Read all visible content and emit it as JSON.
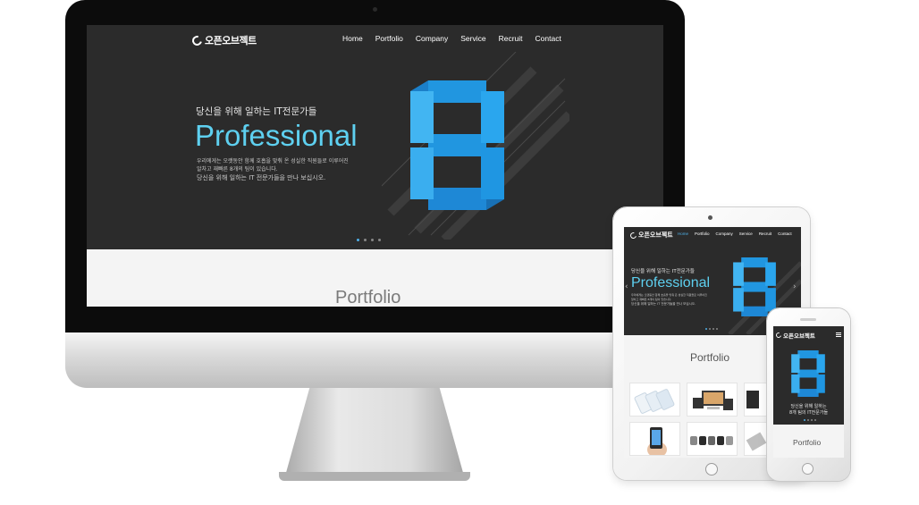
{
  "brand": {
    "name": "오픈오브젝트",
    "accent_color": "#5ed0f0",
    "hero_background": "#2b2b2b",
    "logo_icon": "ring-logo-icon"
  },
  "nav": {
    "items": [
      {
        "label": "Home"
      },
      {
        "label": "Portfolio"
      },
      {
        "label": "Company"
      },
      {
        "label": "Service"
      },
      {
        "label": "Recruit"
      },
      {
        "label": "Contact"
      }
    ],
    "active_color": "#4fb0e8",
    "menu_icon": "hamburger-menu-icon"
  },
  "hero": {
    "subtitle": "당신을 위해 일하는 IT전문가들",
    "title": "Professional",
    "desc_line_1": "우리에게는 오랫동안 함께 호흡을 맞춰 온 성실한 직원들로 이루어진",
    "desc_line_2": "알차고 재빠른 8개의 팀이 있습니다.",
    "desc_line_3": "당신을 위해 일하는 IT 전문가들을 만나 보십시오.",
    "graphic": "blue-folded-number-eight",
    "graphic_color": "#2aa6ee",
    "slide_count": 4,
    "active_slide": 1
  },
  "mobile_hero": {
    "line_1": "당신을 위해 일하는",
    "line_2": "8개 팀의 IT전문가들"
  },
  "carousel": {
    "prev_icon": "chevron-left-icon",
    "next_icon": "chevron-right-icon"
  },
  "portfolio": {
    "title": "Portfolio",
    "thumbnails": [
      {
        "name": "phone-pages-mockup"
      },
      {
        "name": "multi-device-mockup"
      },
      {
        "name": "monitor-mockup"
      },
      {
        "name": "hand-holding-phone"
      },
      {
        "name": "smartwatch-lineup"
      },
      {
        "name": "tablet-mockup"
      }
    ]
  }
}
